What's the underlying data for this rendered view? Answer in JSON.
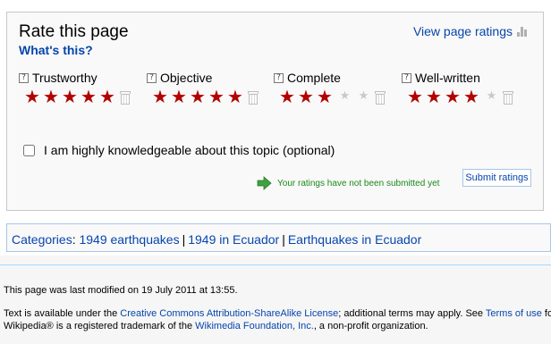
{
  "rating": {
    "title": "Rate this page",
    "whats_this": "What's this?",
    "view_ratings": "View page ratings",
    "help_glyph": "?",
    "criteria": [
      {
        "label": "Trustworthy",
        "stars": 5,
        "max": 5
      },
      {
        "label": "Objective",
        "stars": 5,
        "max": 5
      },
      {
        "label": "Complete",
        "stars": 3,
        "max": 5
      },
      {
        "label": "Well-written",
        "stars": 4,
        "max": 5
      }
    ],
    "knowledgeable_label": "I am highly knowledgeable about this topic (optional)",
    "knowledgeable_checked": false,
    "status_text": "Your ratings have not been submitted yet",
    "submit_label": "Submit ratings",
    "star_color": "#b30000",
    "empty_star_color": "#c9c9c9",
    "status_color": "#1a8a1a"
  },
  "categories": {
    "prefix": "Categories",
    "colon": ":",
    "items": [
      "1949 earthquakes",
      "1949 in Ecuador",
      "Earthquakes in Ecuador"
    ],
    "separator": "|"
  },
  "footer": {
    "modified": "This page was last modified on 19 July 2011 at 13:55.",
    "license_pre": "Text is available under the ",
    "license_link": "Creative Commons Attribution-ShareAlike License",
    "license_mid": "; additional terms may apply. See ",
    "terms_link": "Terms of use",
    "license_post": " for",
    "trademark_pre": "Wikipedia® is a registered trademark of the ",
    "trademark_link": "Wikimedia Foundation, Inc.",
    "trademark_post": ", a non-profit organization."
  }
}
